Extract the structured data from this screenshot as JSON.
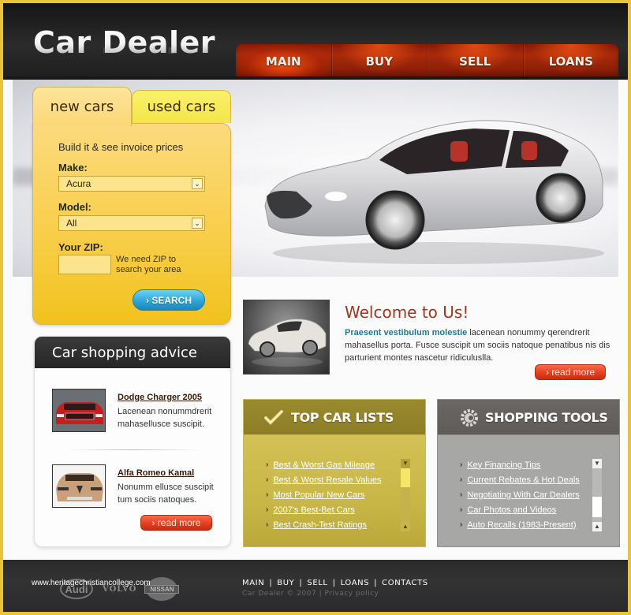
{
  "header": {
    "logo": "Car Dealer",
    "nav": [
      {
        "label": "MAIN",
        "active": true
      },
      {
        "label": "BUY",
        "active": false
      },
      {
        "label": "SELL",
        "active": false
      },
      {
        "label": "LOANS",
        "active": false
      }
    ]
  },
  "search": {
    "tabs": [
      {
        "label": "new cars",
        "active": true
      },
      {
        "label": "used cars",
        "active": false
      }
    ],
    "intro": "Build it & see invoice prices",
    "make_label": "Make:",
    "make_value": "Acura",
    "model_label": "Model:",
    "model_value": "All",
    "zip_label": "Your ZIP:",
    "zip_value": "",
    "zip_note": "We need ZIP to search your area",
    "button_label": "› SEARCH"
  },
  "advice": {
    "title": "Car shopping advice",
    "items": [
      {
        "title": "Dodge Charger 2005",
        "text": "Lacenean nonummdrerit mahasellusce suscipit."
      },
      {
        "title": "Alfa Romeo Kamal",
        "text": "Nonumm ellusce suscipit tum sociis natoques."
      }
    ],
    "read_more": "› read more"
  },
  "welcome": {
    "title": "Welcome to Us!",
    "lead": "Praesent vestibulum molestie",
    "text": " lacenean nonummy qerendrerit mahasellus porta. Fusce suscipit um sociis natoque penatibus nis dis parturient montes nascetur ridiculuslla.",
    "read_more": "› read more"
  },
  "top_car_lists": {
    "title": "TOP CAR LISTS",
    "icon": "checkmark-icon",
    "items": [
      "Best & Worst Gas Mileage",
      "Best & Worst Resale Values",
      "Most Popular New Cars",
      "2007's Best-Bet Cars",
      "Best Crash-Test Ratings"
    ]
  },
  "shopping_tools": {
    "title": "SHOPPING TOOLS",
    "icon": "gear-icon",
    "items": [
      "Key Financing Tips",
      "Current Rebates & Hot Deals",
      "Negotiating With Car Dealers",
      "Car Photos and Videos",
      "Auto Recalls (1983-Present)"
    ]
  },
  "footer": {
    "url": "www.heritagechristiancollege.com",
    "brands": [
      "Audi",
      "VOLVO",
      "NISSAN"
    ],
    "nav": [
      "MAIN",
      "BUY",
      "SELL",
      "LOANS",
      "CONTACTS"
    ],
    "copyright": "Car Dealer © 2007",
    "privacy": "Privacy policy"
  },
  "colors": {
    "accent_red": "#c92c10",
    "panel_yellow": "#f8cd45",
    "search_blue": "#2ea6d7",
    "welcome_title": "#a8321a",
    "lead_teal": "#1f7a98",
    "top_lists_olive": "#8d7e26",
    "tools_gray": "#5e5b58"
  }
}
